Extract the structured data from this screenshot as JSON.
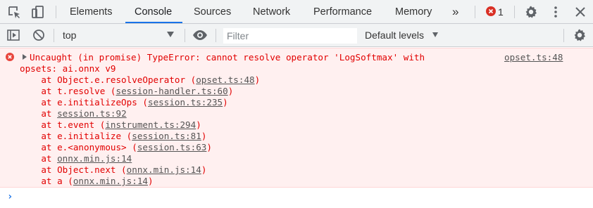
{
  "tabs": [
    {
      "label": "Elements"
    },
    {
      "label": "Console"
    },
    {
      "label": "Sources"
    },
    {
      "label": "Network"
    },
    {
      "label": "Performance"
    },
    {
      "label": "Memory"
    }
  ],
  "more_tabs_label": "»",
  "error_count": "1",
  "toolbar": {
    "context": "top",
    "filter_placeholder": "Filter",
    "levels": "Default levels"
  },
  "error": {
    "message_line1": "Uncaught (in promise) TypeError: cannot resolve operator 'LogSoftmax' with",
    "message_line2": "opsets: ai.onnx v9",
    "source_link": "opset.ts:48",
    "stack": [
      {
        "prefix": "    at Object.e.resolveOperator (",
        "link": "opset.ts:48",
        "suffix": ")"
      },
      {
        "prefix": "    at t.resolve (",
        "link": "session-handler.ts:60",
        "suffix": ")"
      },
      {
        "prefix": "    at e.initializeOps (",
        "link": "session.ts:235",
        "suffix": ")"
      },
      {
        "prefix": "    at ",
        "link": "session.ts:92",
        "suffix": ""
      },
      {
        "prefix": "    at t.event (",
        "link": "instrument.ts:294",
        "suffix": ")"
      },
      {
        "prefix": "    at e.initialize (",
        "link": "session.ts:81",
        "suffix": ")"
      },
      {
        "prefix": "    at e.<anonymous> (",
        "link": "session.ts:63",
        "suffix": ")"
      },
      {
        "prefix": "    at ",
        "link": "onnx.min.js:14",
        "suffix": ""
      },
      {
        "prefix": "    at Object.next (",
        "link": "onnx.min.js:14",
        "suffix": ")"
      },
      {
        "prefix": "    at a (",
        "link": "onnx.min.js:14",
        "suffix": ")"
      }
    ]
  },
  "colors": {
    "accent": "#1a73e8",
    "error_text": "#e20000",
    "error_bg": "#fff0f0"
  },
  "icons": [
    "inspect-element-icon",
    "device-toolbar-icon",
    "more-tabs-icon",
    "error-icon",
    "settings-icon",
    "kebab-menu-icon",
    "close-icon",
    "sidebar-toggle-icon",
    "clear-console-icon",
    "eye-icon",
    "console-settings-icon",
    "expand-arrow-icon",
    "prompt-chevron-icon"
  ]
}
